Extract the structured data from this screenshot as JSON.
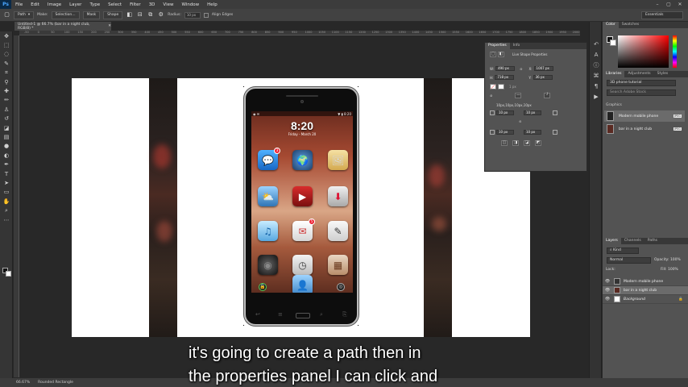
{
  "app": {
    "logo": "Ps"
  },
  "menu": [
    "File",
    "Edit",
    "Image",
    "Layer",
    "Type",
    "Select",
    "Filter",
    "3D",
    "View",
    "Window",
    "Help"
  ],
  "options_bar": {
    "tool_mode": "Path",
    "make_label": "Make:",
    "selection_btn": "Selection...",
    "mask_btn": "Mask",
    "shape_btn": "Shape",
    "radius_label": "Radius:",
    "radius_value": "10 px",
    "align_edges": "Align Edges",
    "workspace": "Essentials"
  },
  "document": {
    "tab_title": "Untitled-1 @ 66.7% (bar in a night club, RGB/8) *",
    "ruler_numbers": [
      "-50",
      "0",
      "50",
      "100",
      "150",
      "200",
      "250",
      "300",
      "350",
      "400",
      "450",
      "500",
      "550",
      "600",
      "650",
      "700",
      "750",
      "800",
      "850",
      "900",
      "950",
      "1000",
      "1050",
      "1100",
      "1150",
      "1200",
      "1250",
      "1300",
      "1350",
      "1400",
      "1450",
      "1500",
      "1550",
      "1600",
      "1650",
      "1700",
      "1750",
      "1800",
      "1850",
      "1900",
      "1950",
      "2000"
    ]
  },
  "phone": {
    "status_left": "◉ ✉",
    "status_right": "▼ ▮ 8:20",
    "time": "8:20",
    "date": "Friday - March 20",
    "badge_messages": "3",
    "badge_mail": "5"
  },
  "properties": {
    "tab_active": "Properties",
    "tab_other": "Info",
    "title": "Live Shape Properties",
    "w_label": "W:",
    "w_value": "490 px",
    "x_label": "X:",
    "x_value": "1007 px",
    "h_label": "H:",
    "h_value": "718 px",
    "y_label": "Y:",
    "y_value": "36 px",
    "stroke_size": "1 px",
    "corners_summary": "10px,10px,10px,10px",
    "corner_tl": "10 px",
    "corner_tr": "10 px",
    "corner_bl": "10 px",
    "corner_br": "10 px"
  },
  "color_panel": {
    "tab_active": "Color",
    "tab_other": "Swatches"
  },
  "libraries": {
    "tabs": [
      "Libraries",
      "Adjustments",
      "Styles"
    ],
    "selected": "3D phone tutorial",
    "search_placeholder": "Search Adobe Stock",
    "section": "Graphics",
    "items": [
      {
        "name": "Modern mobile phone",
        "tag": "JPEG"
      },
      {
        "name": "bar in a night club",
        "tag": "JPEG"
      }
    ]
  },
  "layers": {
    "tabs": [
      "Layers",
      "Channels",
      "Paths"
    ],
    "kind": "Kind",
    "blend": "Normal",
    "opacity_label": "Opacity:",
    "opacity": "100%",
    "lock_label": "Lock:",
    "fill_label": "Fill:",
    "fill": "100%",
    "rows": [
      {
        "name": "Modern mobile phone"
      },
      {
        "name": "bar in a night club"
      },
      {
        "name": "Background"
      }
    ]
  },
  "status": {
    "zoom": "66.67%",
    "tool": "Rounded Rectangle"
  },
  "subtitles": {
    "line1": "it's going to create a path then in",
    "line2": "the properties panel I can click and"
  }
}
